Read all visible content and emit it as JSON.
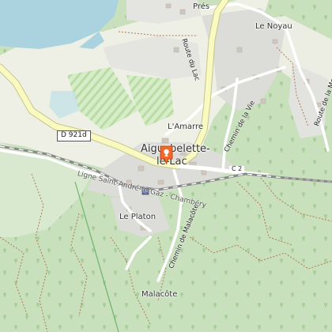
{
  "map": {
    "places": {
      "pres": "Prés",
      "le_noyau": "Le Noyau",
      "lamarre": "L'Amarre",
      "aiguebelette_line1": "Aiguebelette-",
      "aiguebelette_line2": "le-Lac",
      "le_platon": "Le Platon",
      "malacote": "Malacôte"
    },
    "roads": {
      "route_du_lac": "Route du Lac",
      "chemin_de_la_vie": "Chemin de la Vie",
      "route_de_la_montagne": "Route de la Montagne",
      "chemin_de_malacote": "Chemin de Malacôte",
      "ligne_ferroviaire": "Ligne Saint-André-le-Gaz - Chambéry"
    },
    "shields": {
      "d921d": "D 921d",
      "c2": "C 2"
    },
    "marker": {
      "icon": "map-pin-icon",
      "color": "#f0682c"
    },
    "colors": {
      "lake": "#aad3df",
      "forest": "#c5dfb8",
      "residential": "#e0e0e0",
      "main_road": "#f8fabf",
      "road_casing": "#c9c48a",
      "railway": "#777777",
      "path": "#b07a5a"
    }
  }
}
